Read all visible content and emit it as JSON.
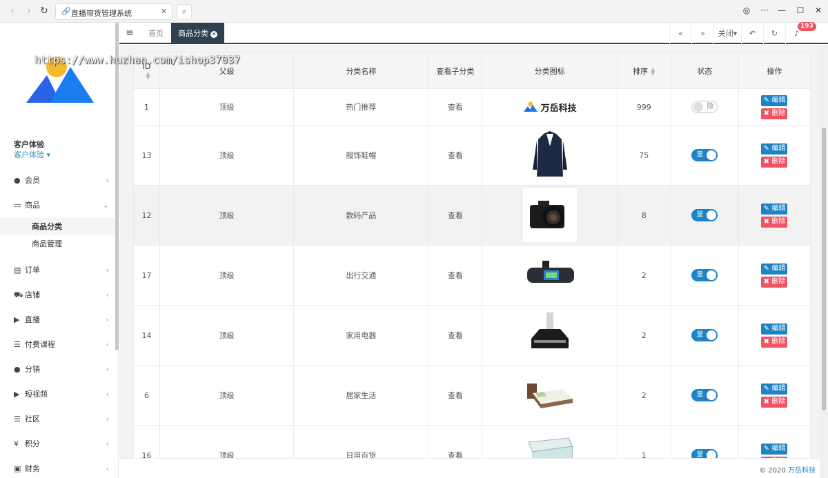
{
  "browser": {
    "tab_title": "直播带货管理系统"
  },
  "sidebar": {
    "watermark": "https://www.huzhan.com/ishop37037",
    "user_name": "客户体验",
    "user_role": "客户体验",
    "menu": [
      {
        "label": "会员",
        "icon": "user-icon"
      },
      {
        "label": "商品",
        "icon": "laptop-icon"
      },
      {
        "label": "订单",
        "icon": "order-icon"
      },
      {
        "label": "店铺",
        "icon": "cart-icon"
      },
      {
        "label": "直播",
        "icon": "video-icon"
      },
      {
        "label": "付费课程",
        "icon": "list-icon"
      },
      {
        "label": "分销",
        "icon": "users-icon"
      },
      {
        "label": "短视频",
        "icon": "video-icon"
      },
      {
        "label": "社区",
        "icon": "list-icon"
      },
      {
        "label": "积分",
        "icon": "yen-icon"
      },
      {
        "label": "财务",
        "icon": "money-icon"
      }
    ],
    "submenu": [
      {
        "label": "商品分类",
        "active": true
      },
      {
        "label": "商品管理",
        "active": false
      }
    ]
  },
  "topnav": {
    "home": "首页",
    "active_tab": "商品分类",
    "close": "关闭",
    "badge": "193"
  },
  "table": {
    "headers": {
      "id": "ID",
      "parent": "父级",
      "name": "分类名称",
      "view_sub": "查看子分类",
      "icon": "分类图标",
      "sort": "排序",
      "status": "状态",
      "actions": "操作"
    },
    "rows": [
      {
        "id": "1",
        "parent": "顶级",
        "name": "热门推荐",
        "view": "查看",
        "icon": "brand-logo",
        "sort": "999",
        "status": "隐",
        "on": false
      },
      {
        "id": "13",
        "parent": "顶级",
        "name": "服饰鞋帽",
        "view": "查看",
        "icon": "suit-image",
        "sort": "75",
        "status": "显",
        "on": true
      },
      {
        "id": "12",
        "parent": "顶级",
        "name": "数码产品",
        "view": "查看",
        "icon": "camera-image",
        "sort": "8",
        "status": "显",
        "on": true
      },
      {
        "id": "17",
        "parent": "顶级",
        "name": "出行交通",
        "view": "查看",
        "icon": "mirror-image",
        "sort": "2",
        "status": "显",
        "on": true
      },
      {
        "id": "14",
        "parent": "顶级",
        "name": "家用电器",
        "view": "查看",
        "icon": "range-hood-image",
        "sort": "2",
        "status": "显",
        "on": true
      },
      {
        "id": "6",
        "parent": "顶级",
        "name": "居家生活",
        "view": "查看",
        "icon": "bed-image",
        "sort": "2",
        "status": "显",
        "on": true
      },
      {
        "id": "16",
        "parent": "顶级",
        "name": "日用百货",
        "view": "查看",
        "icon": "box-image",
        "sort": "1",
        "status": "显",
        "on": true
      }
    ],
    "brand_name": "万岳科技",
    "edit_label": "编辑",
    "delete_label": "删除"
  },
  "footer": {
    "copyright": "© 2020",
    "company": "万岳科技"
  },
  "colors": {
    "accent": "#1c84c6",
    "danger": "#ed5565",
    "nav_dark": "#2f4050"
  }
}
